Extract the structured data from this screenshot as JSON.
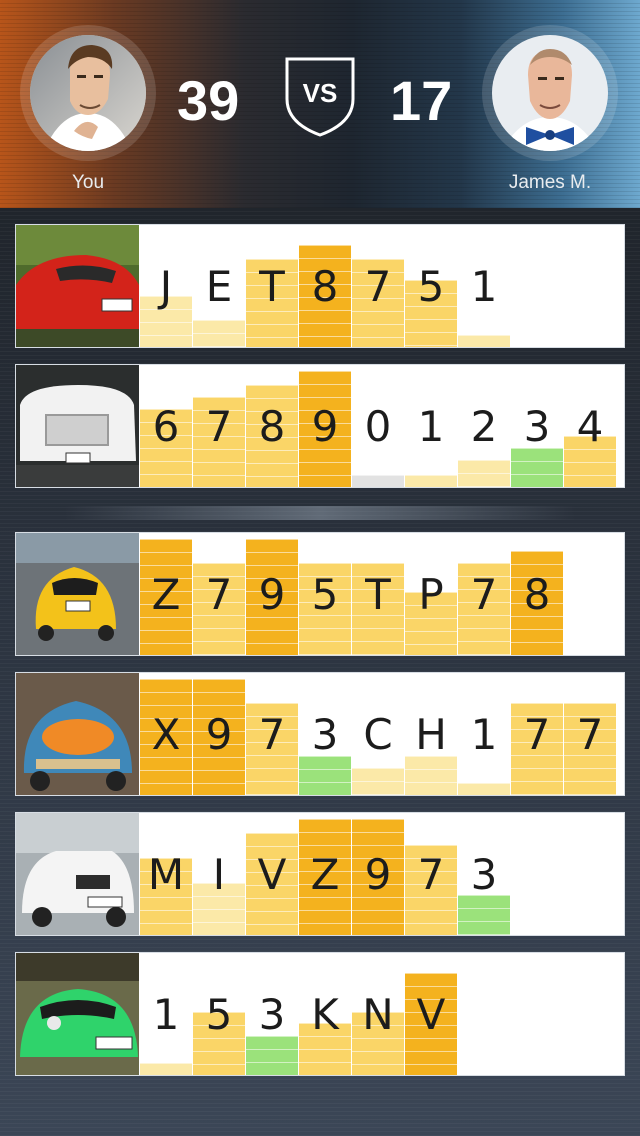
{
  "players": {
    "left": {
      "name": "You",
      "score": "39"
    },
    "right": {
      "name": "James M.",
      "score": "17"
    },
    "versus_label": "VS"
  },
  "colors": {
    "hot": "#f4b21e",
    "warm": "#fad567",
    "cool": "#fbe9a8",
    "green": "#9be27b",
    "grey": "#e2e2e2"
  },
  "plates": [
    {
      "car": "red sports car",
      "chars": [
        "J",
        "E",
        "T",
        "8",
        "7",
        "5",
        "1"
      ],
      "levels": [
        0.42,
        0.22,
        0.72,
        0.84,
        0.72,
        0.55,
        0.1
      ],
      "tones": [
        "cool",
        "cool",
        "warm",
        "hot",
        "warm",
        "warm",
        "cool"
      ]
    },
    {
      "car": "white pickup truck",
      "chars": [
        "6",
        "7",
        "8",
        "9",
        "0",
        "1",
        "2",
        "3",
        "4"
      ],
      "levels": [
        0.64,
        0.74,
        0.84,
        0.95,
        0.1,
        0.1,
        0.22,
        0.32,
        0.42
      ],
      "tones": [
        "warm",
        "warm",
        "warm",
        "hot",
        "grey",
        "cool",
        "cool",
        "green",
        "warm"
      ]
    },
    {
      "car": "yellow classic car",
      "chars": [
        "Z",
        "7",
        "9",
        "5",
        "T",
        "P",
        "7",
        "8"
      ],
      "levels": [
        0.95,
        0.75,
        0.95,
        0.75,
        0.75,
        0.52,
        0.75,
        0.85
      ],
      "tones": [
        "hot",
        "warm",
        "hot",
        "warm",
        "warm",
        "warm",
        "warm",
        "hot"
      ]
    },
    {
      "car": "painted vintage van",
      "chars": [
        "X",
        "9",
        "7",
        "3",
        "C",
        "H",
        "1",
        "7",
        "7"
      ],
      "levels": [
        0.95,
        0.95,
        0.75,
        0.32,
        0.22,
        0.32,
        0.1,
        0.75,
        0.75
      ],
      "tones": [
        "hot",
        "hot",
        "warm",
        "green",
        "cool",
        "cool",
        "cool",
        "warm",
        "warm"
      ]
    },
    {
      "car": "white SUV",
      "chars": [
        "M",
        "I",
        "V",
        "Z",
        "9",
        "7",
        "3"
      ],
      "levels": [
        0.63,
        0.43,
        0.84,
        0.95,
        0.95,
        0.74,
        0.33
      ],
      "tones": [
        "warm",
        "cool",
        "warm",
        "hot",
        "hot",
        "warm",
        "green"
      ]
    },
    {
      "car": "green sports car",
      "chars": [
        "1",
        "5",
        "3",
        "K",
        "N",
        "V"
      ],
      "levels": [
        0.1,
        0.52,
        0.32,
        0.43,
        0.52,
        0.84
      ],
      "tones": [
        "cool",
        "warm",
        "green",
        "warm",
        "warm",
        "hot"
      ]
    }
  ]
}
